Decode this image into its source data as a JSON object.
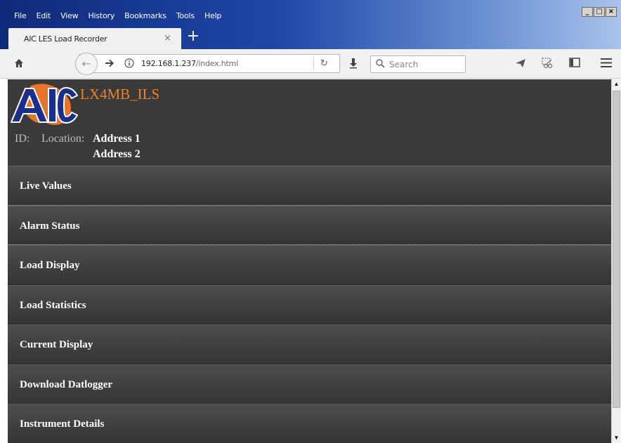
{
  "browser": {
    "menu": [
      "File",
      "Edit",
      "View",
      "History",
      "Bookmarks",
      "Tools",
      "Help"
    ],
    "window_controls": [
      "_",
      "□",
      "×"
    ],
    "tab_title": "AIC LES Load Recorder",
    "tab_close": "×",
    "new_tab": "+",
    "url_host": "192.168.1.237",
    "url_path": "/index.html",
    "search_placeholder": "Search"
  },
  "header": {
    "logo_text": "AIC",
    "device_name": "LX4MB_ILS",
    "id_label": "ID:",
    "location_label": "Location:",
    "address_line1": "Address 1",
    "address_line2": "Address 2"
  },
  "menu": [
    {
      "label": "Live Values"
    },
    {
      "label": "Alarm Status"
    },
    {
      "label": "Load Display"
    },
    {
      "label": "Load Statistics"
    },
    {
      "label": "Current Display"
    },
    {
      "label": "Download Datlogger"
    },
    {
      "label": "Instrument Details"
    }
  ],
  "colors": {
    "accent": "#f08020",
    "page_bg": "#3a3a3a",
    "logo_blue": "#1a2f8c"
  }
}
